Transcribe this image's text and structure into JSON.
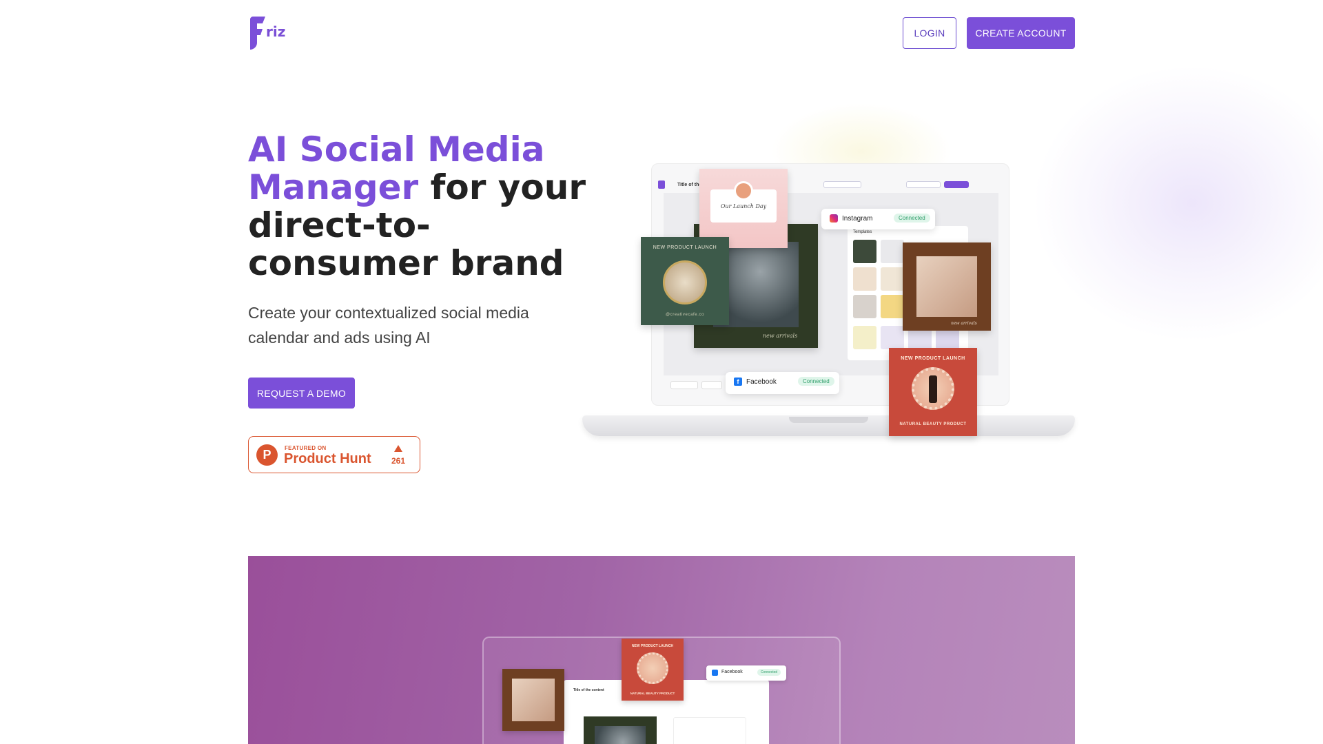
{
  "brand": {
    "name": "Friz",
    "logo_text": "riz",
    "color": "#7b4fd9"
  },
  "header": {
    "login_label": "LOGIN",
    "create_account_label": "CREATE ACCOUNT"
  },
  "hero": {
    "title_highlight": "AI Social Media Manager",
    "title_rest": " for your direct-to-consumer brand",
    "subtitle": "Create your contextualized social media calendar and ads using AI",
    "demo_button_label": "REQUEST A DEMO"
  },
  "product_hunt": {
    "featured_label": "FEATURED ON",
    "name": "Product Hunt",
    "letter": "P",
    "upvotes": "261",
    "color": "#da552f"
  },
  "mockup": {
    "app_title": "Title of the",
    "card_launch_text": "Our Launch Day",
    "card_green_label": "NEW PRODUCT LAUNCH",
    "card_green_footer": "@creativecafe.co",
    "card_cat_signature": "new arrivals",
    "card_woman_signature": "new arrivals",
    "card_red_label": "NEW PRODUCT LAUNCH",
    "card_red_footer": "NATURAL BEAUTY PRODUCT",
    "templates_label": "Templates",
    "instagram": {
      "name": "Instagram",
      "status": "Connected"
    },
    "facebook": {
      "name": "Facebook",
      "status": "Connected"
    }
  },
  "promo_mockup": {
    "app_title": "Title of the content",
    "card_red_label": "NEW PRODUCT LAUNCH",
    "card_red_footer": "NATURAL BEAUTY PRODUCT",
    "facebook": {
      "name": "Facebook",
      "status": "Connected"
    },
    "gradient_start": "#9a4f9a",
    "gradient_end": "#b98dbd"
  }
}
